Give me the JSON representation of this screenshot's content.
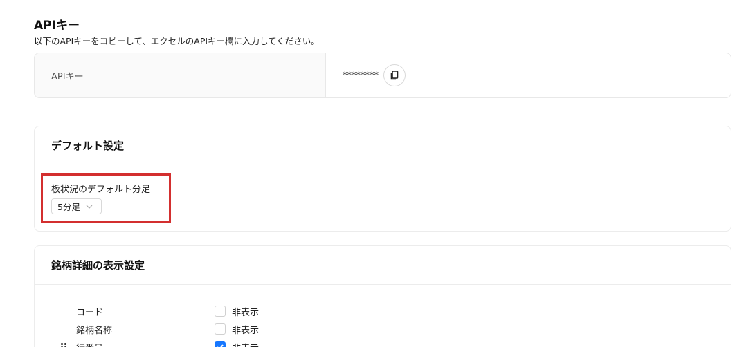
{
  "api": {
    "title": "APIキー",
    "description": "以下のAPIキーをコピーして、エクセルのAPIキー欄に入力してください。",
    "label": "APIキー",
    "value": "********"
  },
  "default_settings": {
    "title": "デフォルト設定",
    "board_label": "板状況のデフォルト分足",
    "board_value": "5分足"
  },
  "stock_detail": {
    "title": "銘柄詳細の表示設定",
    "rows": [
      {
        "name": "コード",
        "checkbox_label": "非表示",
        "checked": false
      },
      {
        "name": "銘柄名称",
        "checkbox_label": "非表示",
        "checked": false
      },
      {
        "name": "行番号",
        "checkbox_label": "非表示",
        "checked": true
      }
    ]
  },
  "colors": {
    "accent": "#1677ff",
    "highlight": "#d32f2f"
  }
}
